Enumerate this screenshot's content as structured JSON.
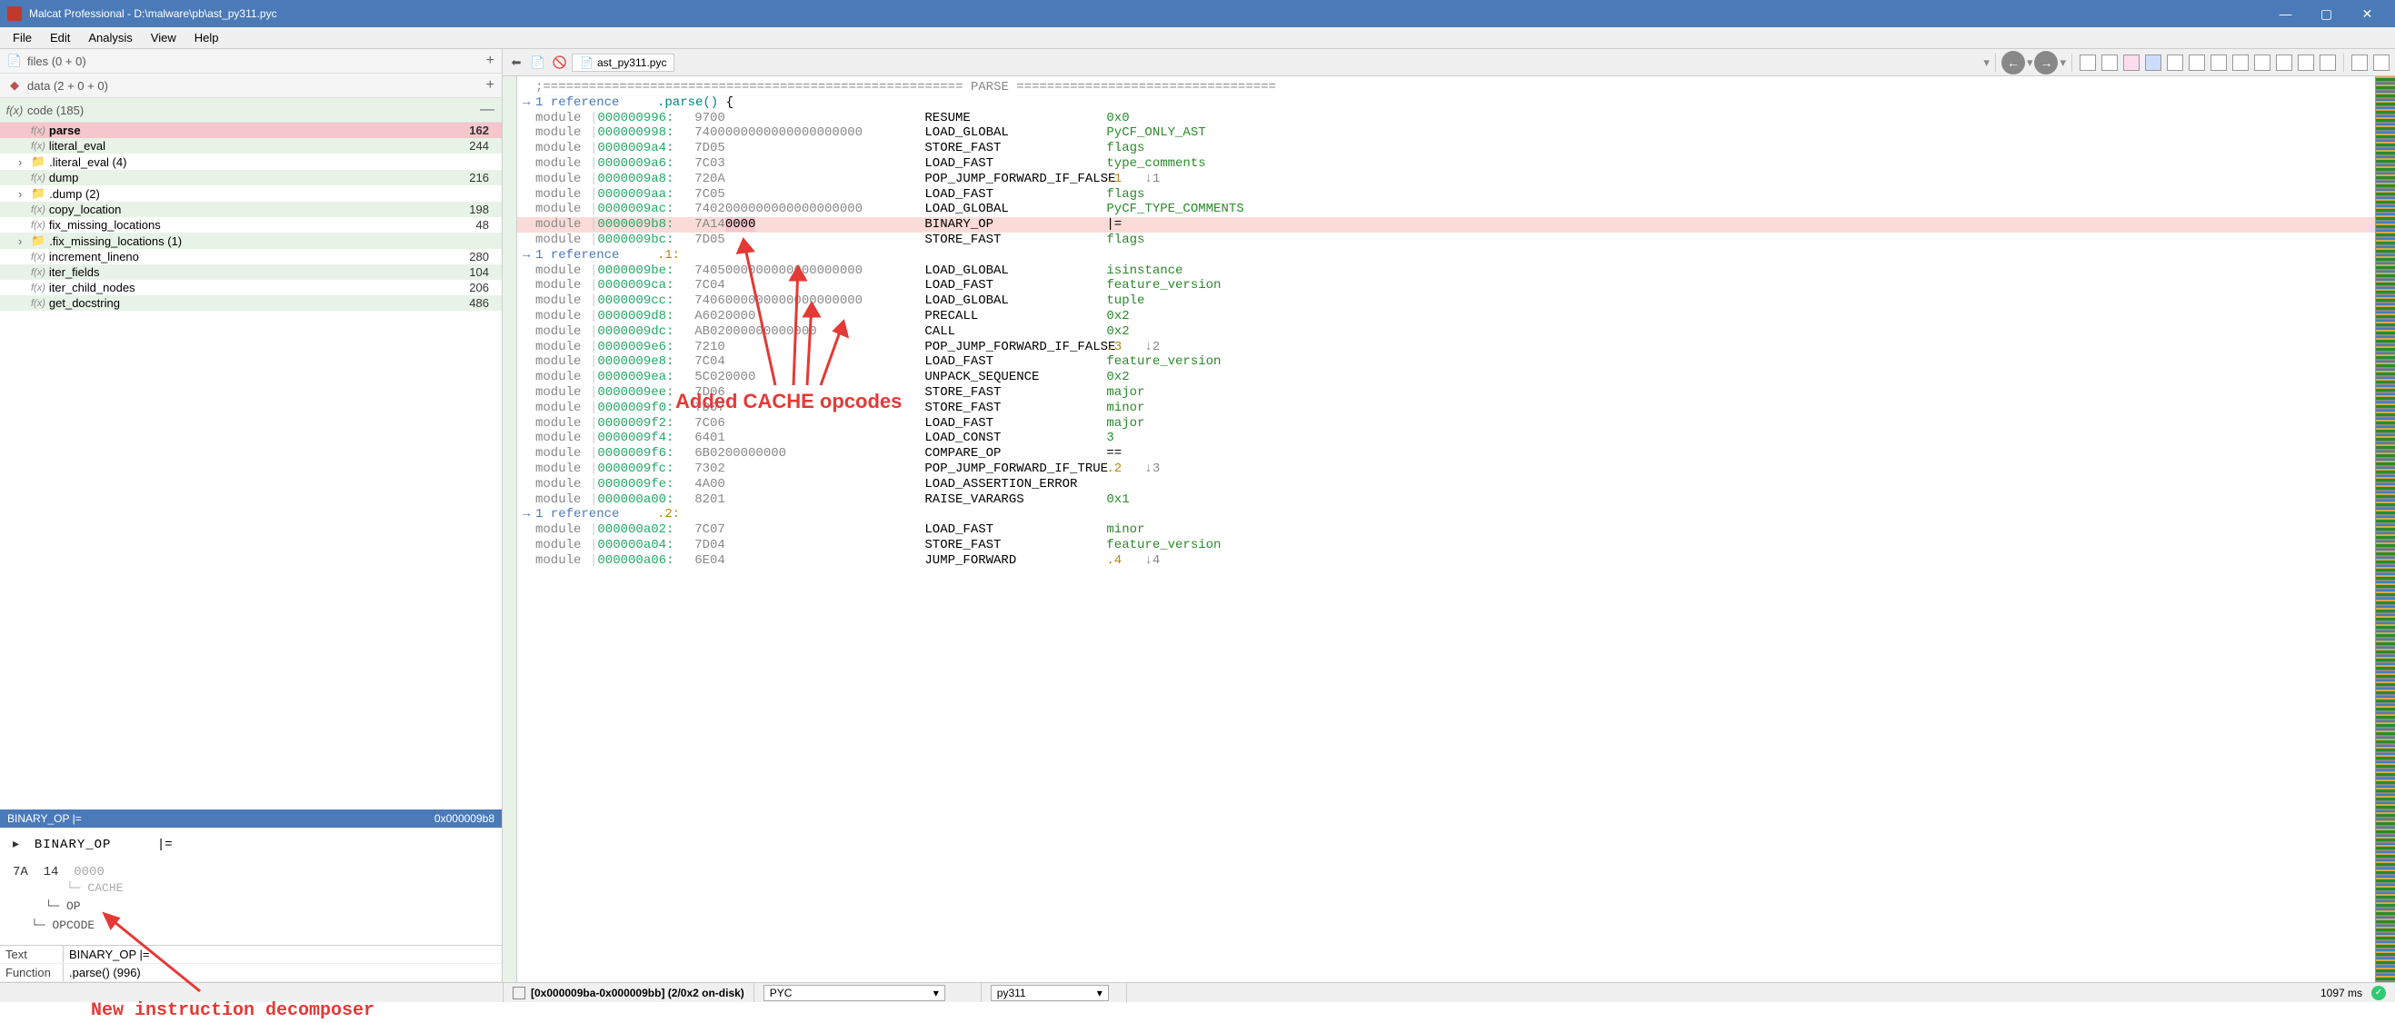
{
  "window": {
    "title": "Malcat Professional - D:\\malware\\pb\\ast_py311.pyc"
  },
  "menu": [
    "File",
    "Edit",
    "Analysis",
    "View",
    "Help"
  ],
  "left": {
    "files_label": "files (0 + 0)",
    "data_label": "data (2 + 0 + 0)",
    "code_label": "code (185)",
    "items": [
      {
        "type": "fx",
        "name": "parse",
        "count": "162",
        "sel": true
      },
      {
        "type": "fx",
        "name": "literal_eval",
        "count": "244",
        "alt": true
      },
      {
        "type": "folder",
        "name": "<module>.literal_eval (4)",
        "count": ""
      },
      {
        "type": "fx",
        "name": "dump",
        "count": "216",
        "alt": true
      },
      {
        "type": "folder",
        "name": "<module>.dump (2)",
        "count": ""
      },
      {
        "type": "fx",
        "name": "copy_location",
        "count": "198",
        "alt": true
      },
      {
        "type": "fx",
        "name": "fix_missing_locations",
        "count": "48"
      },
      {
        "type": "folder",
        "name": "<module>.fix_missing_locations (1)",
        "count": "",
        "alt": true
      },
      {
        "type": "fx",
        "name": "increment_lineno",
        "count": "280"
      },
      {
        "type": "fx",
        "name": "iter_fields",
        "count": "104",
        "alt": true
      },
      {
        "type": "fx",
        "name": "iter_child_nodes",
        "count": "206"
      },
      {
        "type": "fx",
        "name": "get_docstring",
        "count": "486",
        "alt": true
      }
    ],
    "infobar_left": "BINARY_OP |=",
    "infobar_right": "0x000009b8",
    "decomp": {
      "op": "BINARY_OP",
      "arg": "|=",
      "hex1": "7A",
      "hex2": "14",
      "hex3": "0000",
      "tree": [
        "CACHE",
        "OP",
        "OPCODE"
      ]
    },
    "annotation": "New instruction decomposer",
    "grid": [
      {
        "k": "Text",
        "v": "BINARY_OP |="
      },
      {
        "k": "Function",
        "v": "<module>.parse() (996)"
      }
    ]
  },
  "right": {
    "tab_name": "ast_py311.pyc",
    "parse_header": ";======================================================= PARSE ==================================",
    "func_sig": "<module>.parse() {",
    "annotation": "Added CACHE opcodes",
    "lines": [
      {
        "ref": "→ 1 reference"
      },
      {
        "mod": "module",
        "addr": "000000996:",
        "hex": "9700",
        "op": "RESUME",
        "arg": "0x0",
        "argcls": "num"
      },
      {
        "mod": "module",
        "addr": "000000998:",
        "hex": "7400000000000000000000",
        "op": "LOAD_GLOBAL",
        "arg": "PyCF_ONLY_AST",
        "argcls": "sym"
      },
      {
        "mod": "module",
        "addr": "0000009a4:",
        "hex": "7D05",
        "op": "STORE_FAST",
        "arg": "flags",
        "argcls": "sym"
      },
      {
        "mod": "module",
        "addr": "0000009a6:",
        "hex": "7C03",
        "op": "LOAD_FAST",
        "arg": "type_comments",
        "argcls": "sym"
      },
      {
        "mod": "module",
        "addr": "0000009a8:",
        "hex": "720A",
        "op": "POP_JUMP_FORWARD_IF_FALSE",
        "arg": ".1",
        "argcls": "lbl",
        "jmp": "↓1"
      },
      {
        "mod": "module",
        "addr": "0000009aa:",
        "hex": "7C05",
        "op": "LOAD_FAST",
        "arg": "flags",
        "argcls": "sym"
      },
      {
        "mod": "module",
        "addr": "0000009ac:",
        "hex": "7402000000000000000000",
        "op": "LOAD_GLOBAL",
        "arg": "PyCF_TYPE_COMMENTS",
        "argcls": "sym"
      },
      {
        "mod": "module",
        "addr": "0000009b8:",
        "hex": "7A14",
        "hexhl": "0000",
        "op": "BINARY_OP",
        "arg": "|=",
        "hl": true
      },
      {
        "mod": "module",
        "addr": "0000009bc:",
        "hex": "7D05",
        "op": "STORE_FAST",
        "arg": "flags",
        "argcls": "sym"
      },
      {
        "ref": "→ 1 reference",
        "label": ".1:"
      },
      {
        "mod": "module",
        "addr": "0000009be:",
        "hex": "7405000000000000000000",
        "op": "LOAD_GLOBAL",
        "arg": "isinstance",
        "argcls": "sym"
      },
      {
        "mod": "module",
        "addr": "0000009ca:",
        "hex": "7C04",
        "op": "LOAD_FAST",
        "arg": "feature_version",
        "argcls": "sym"
      },
      {
        "mod": "module",
        "addr": "0000009cc:",
        "hex": "7406000000000000000000",
        "op": "LOAD_GLOBAL",
        "arg": "tuple",
        "argcls": "sym"
      },
      {
        "mod": "module",
        "addr": "0000009d8:",
        "hex": "A6020000",
        "op": "PRECALL",
        "arg": "0x2",
        "argcls": "num"
      },
      {
        "mod": "module",
        "addr": "0000009dc:",
        "hex": "AB02000000000000",
        "op": "CALL",
        "arg": "0x2",
        "argcls": "num"
      },
      {
        "mod": "module",
        "addr": "0000009e6:",
        "hex": "7210",
        "op": "POP_JUMP_FORWARD_IF_FALSE",
        "arg": ".3",
        "argcls": "lbl",
        "jmp": "↓2"
      },
      {
        "mod": "module",
        "addr": "0000009e8:",
        "hex": "7C04",
        "op": "LOAD_FAST",
        "arg": "feature_version",
        "argcls": "sym"
      },
      {
        "mod": "module",
        "addr": "0000009ea:",
        "hex": "5C020000",
        "op": "UNPACK_SEQUENCE",
        "arg": "0x2",
        "argcls": "num"
      },
      {
        "mod": "module",
        "addr": "0000009ee:",
        "hex": "7D06",
        "op": "STORE_FAST",
        "arg": "major",
        "argcls": "sym"
      },
      {
        "mod": "module",
        "addr": "0000009f0:",
        "hex": "7D07",
        "op": "STORE_FAST",
        "arg": "minor",
        "argcls": "sym"
      },
      {
        "mod": "module",
        "addr": "0000009f2:",
        "hex": "7C06",
        "op": "LOAD_FAST",
        "arg": "major",
        "argcls": "sym"
      },
      {
        "mod": "module",
        "addr": "0000009f4:",
        "hex": "6401",
        "op": "LOAD_CONST",
        "arg": "3",
        "argcls": "num"
      },
      {
        "mod": "module",
        "addr": "0000009f6:",
        "hex": "6B0200000000",
        "op": "COMPARE_OP",
        "arg": "=="
      },
      {
        "mod": "module",
        "addr": "0000009fc:",
        "hex": "7302",
        "op": "POP_JUMP_FORWARD_IF_TRUE",
        "arg": ".2",
        "argcls": "lbl",
        "jmp": "↓3"
      },
      {
        "mod": "module",
        "addr": "0000009fe:",
        "hex": "4A00",
        "op": "LOAD_ASSERTION_ERROR",
        "arg": ""
      },
      {
        "mod": "module",
        "addr": "000000a00:",
        "hex": "8201",
        "op": "RAISE_VARARGS",
        "arg": "0x1",
        "argcls": "num"
      },
      {
        "ref": "→ 1 reference",
        "label": ".2:"
      },
      {
        "mod": "module",
        "addr": "000000a02:",
        "hex": "7C07",
        "op": "LOAD_FAST",
        "arg": "minor",
        "argcls": "sym"
      },
      {
        "mod": "module",
        "addr": "000000a04:",
        "hex": "7D04",
        "op": "STORE_FAST",
        "arg": "feature_version",
        "argcls": "sym"
      },
      {
        "mod": "module",
        "addr": "000000a06:",
        "hex": "6E04",
        "op": "JUMP_FORWARD",
        "arg": ".4",
        "argcls": "lbl",
        "jmp": "↓4"
      }
    ]
  },
  "status": {
    "range": "[0x000009ba-0x000009bb] (2/0x2 on-disk)",
    "sel1": "PYC",
    "sel2": "py311",
    "time": "1097 ms"
  }
}
